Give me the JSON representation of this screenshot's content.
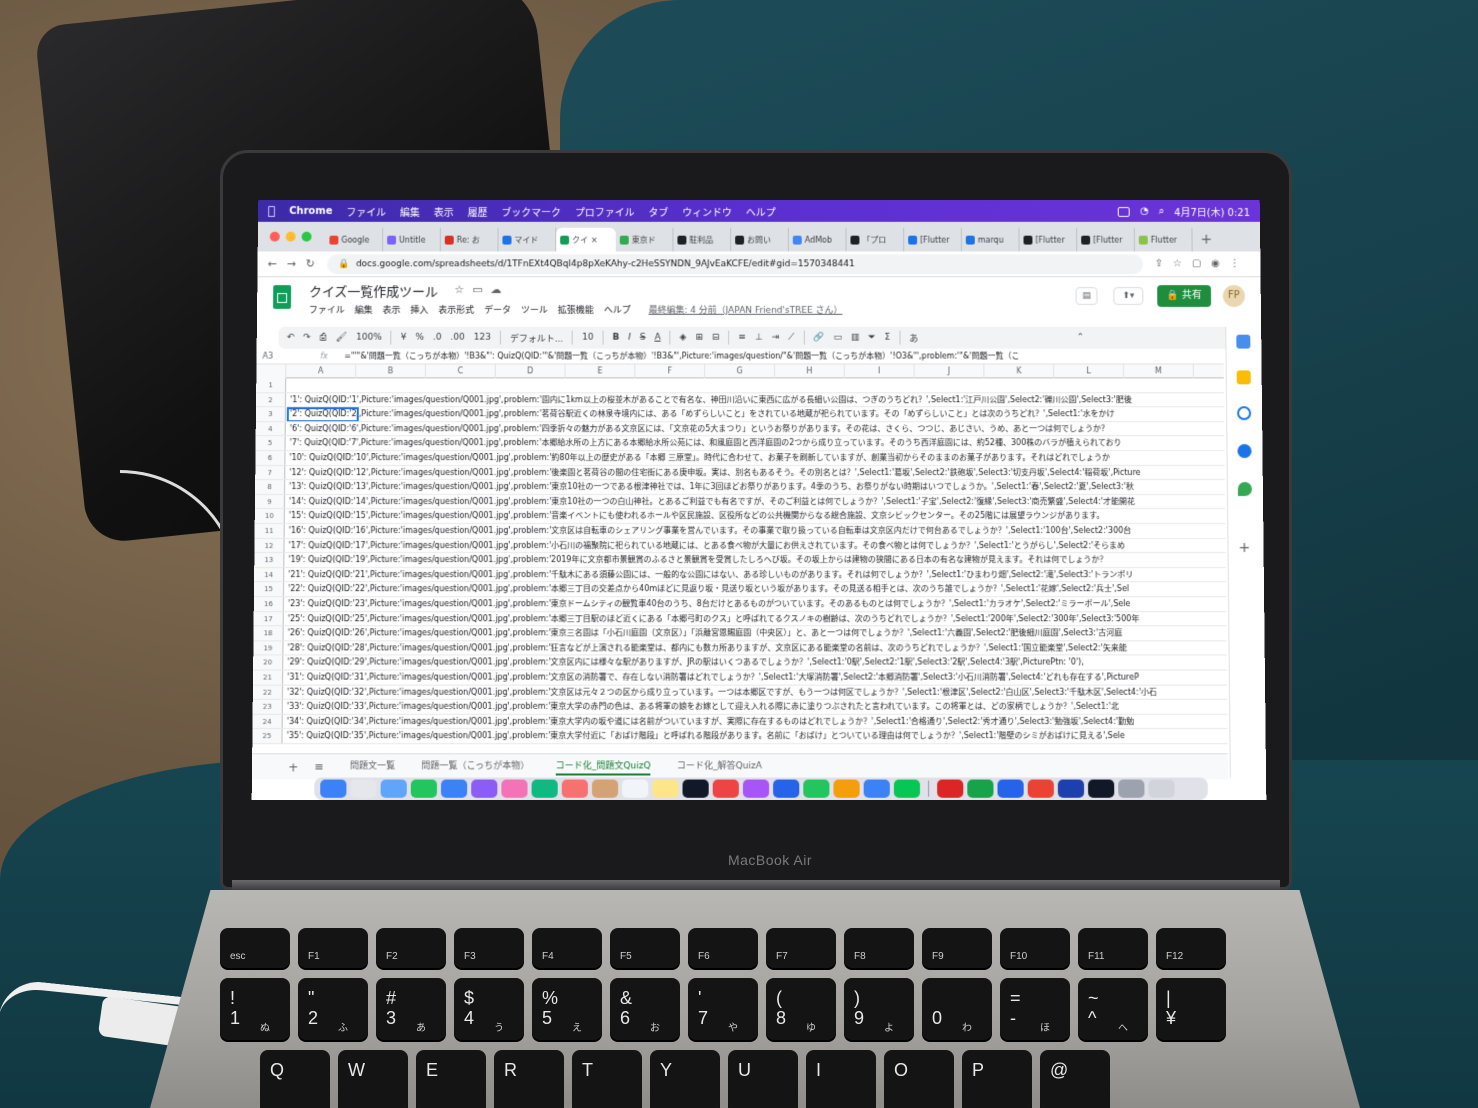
{
  "menubar": {
    "app": "Chrome",
    "items": [
      "ファイル",
      "編集",
      "表示",
      "履歴",
      "ブックマーク",
      "プロファイル",
      "タブ",
      "ウィンドウ",
      "ヘルプ"
    ],
    "clock": "4月7日(木) 0:21"
  },
  "tabs": [
    {
      "label": "Google",
      "color": "#ea4335"
    },
    {
      "label": "Untitle",
      "color": "#7b61ff"
    },
    {
      "label": "Re: お",
      "color": "#d93025"
    },
    {
      "label": "マイド",
      "color": "#1a73e8"
    },
    {
      "label": "クイ",
      "color": "#0f9d58",
      "active": true
    },
    {
      "label": "東京ド",
      "color": "#34a853"
    },
    {
      "label": "駐利品",
      "color": "#202124"
    },
    {
      "label": "お問い",
      "color": "#202124"
    },
    {
      "label": "AdMob",
      "color": "#4285f4"
    },
    {
      "label": "「プロ",
      "color": "#202124"
    },
    {
      "label": "[Flutter",
      "color": "#1a73e8"
    },
    {
      "label": "marqu",
      "color": "#1a73e8"
    },
    {
      "label": "[Flutter",
      "color": "#202124"
    },
    {
      "label": "[Flutter",
      "color": "#202124"
    },
    {
      "label": "Flutter",
      "color": "#8bc34a"
    }
  ],
  "address": {
    "url": "docs.google.com/spreadsheets/d/1TFnEXt4QBql4p8pXeKAhy-c2HeSSYNDN_9AJvEaKCFE/edit#gid=1570348441"
  },
  "sheet": {
    "title": "クイズ一覧作成ツール",
    "menus": [
      "ファイル",
      "編集",
      "表示",
      "挿入",
      "表示形式",
      "データ",
      "ツール",
      "拡張機能",
      "ヘルプ"
    ],
    "last_edit": "最終編集: 4 分前（JAPAN Friend'sTREE さん）",
    "share_label": "🔒 共有",
    "avatar": "FP"
  },
  "toolbar": {
    "zoom": "100%",
    "currency": "¥",
    "percent": "%",
    "dec1": ".0",
    "dec2": ".00",
    "format": "123",
    "font": "デフォルト...",
    "size": "10",
    "bold": "B",
    "italic": "I",
    "strike": "S",
    "color": "A",
    "input_tool": "あ"
  },
  "formula_bar": {
    "name_box": "A3",
    "fx": "fx",
    "formula": "=\"'\"&'問題一覧（こっちが本物）'!B3&\"': QuizQ(QID:'\"&'問題一覧（こっちが本物）'!B3&\"',Picture:'images/question/\"&'問題一覧（こっちが本物）'!O3&\"',problem:'\"&'問題一覧（こ"
  },
  "columns": [
    "A",
    "B",
    "C",
    "D",
    "E",
    "F",
    "G",
    "H",
    "I",
    "J",
    "K",
    "L",
    "M"
  ],
  "rows": [
    {
      "num": "1",
      "text": ""
    },
    {
      "num": "2",
      "text": "'1': QuizQ(QID:'1',Picture:'images/question/Q001.jpg',problem:'園内に1km以上の桜並木があることで有名な、神田川沿いに東西に広がる長細い公園は、つぎのうちどれ？',Select1:'江戸川公園',Select2:'礫川公園',Select3:'肥後"
    },
    {
      "num": "3",
      "text": "'2': QuizQ(QID:'2',Picture:'images/question/Q001.jpg',problem:'茗荷谷駅近くの林泉寺境内には、ある「めずらしいこと」をされている地蔵が祀られています。その「めずらしいこと」とは次のうちどれ？',Select1:'水をかけ",
      "selected": true
    },
    {
      "num": "4",
      "text": "'6': QuizQ(QID:'6',Picture:'images/question/Q001.jpg',problem:'四季折々の魅力がある文京区には、「文京花の5大まつり」というお祭りがあります。その花は、さくら、つつじ、あじさい、うめ、あと一つは何でしょうか？"
    },
    {
      "num": "5",
      "text": "'7': QuizQ(QID:'7',Picture:'images/question/Q001.jpg',problem:'本郷給水所の上方にある本郷給水所公苑には、和風庭園と西洋庭園の2つから成り立っています。そのうち西洋庭園には、約52種、300株のバラが植えられており"
    },
    {
      "num": "6",
      "text": "'10': QuizQ(QID:'10',Picture:'images/question/Q001.jpg',problem:'約80年以上の歴史がある「本郷 三原堂」。時代に合わせて、お菓子を刷新していますが、創業当初からそのままのお菓子があります。それはどれでしょうか"
    },
    {
      "num": "7",
      "text": "'12': QuizQ(QID:'12',Picture:'images/question/Q001.jpg',problem:'後楽園と茗荷谷の間の住宅街にある庚申坂。実は、別名もあるそう。その別名とは？',Select1:'葛坂',Select2:'鉄砲坂',Select3:'切支丹坂',Select4:'稲荷坂',Picture"
    },
    {
      "num": "8",
      "text": "'13': QuizQ(QID:'13',Picture:'images/question/Q001.jpg',problem:'東京10社の一つである根津神社では、1年に3回ほどお祭りがあります。4季のうち、お祭りがない時期はいつでしょうか。',Select1:'春',Select2:'夏',Select3:'秋"
    },
    {
      "num": "9",
      "text": "'14': QuizQ(QID:'14',Picture:'images/question/Q001.jpg',problem:'東京10社の一つの白山神社。とあるご利益でも有名ですが、そのご利益とは何でしょうか？',Select1:'子宝',Select2:'復縁',Select3:'商売繁盛',Select4:'才能開花"
    },
    {
      "num": "10",
      "text": "'15': QuizQ(QID:'15',Picture:'images/question/Q001.jpg',problem:'音楽イベントにも使われるホールや区民施設、区役所などの公共機関からなる総合施設、文京シビックセンター。その25階には展望ラウンジがあります。"
    },
    {
      "num": "11",
      "text": "'16': QuizQ(QID:'16',Picture:'images/question/Q001.jpg',problem:'文京区は自転車のシェアリング事業を営んでいます。その事業で取り扱っている自転車は文京区内だけで何台あるでしょうか？',Select1:'100台',Select2:'300台"
    },
    {
      "num": "12",
      "text": "'17': QuizQ(QID:'17',Picture:'images/question/Q001.jpg',problem:'小石川の福聚院に祀られている地蔵には、とある食べ物が大量にお供えされています。その食べ物とは何でしょうか？',Select1:'とうがらし',Select2:'そらまめ"
    },
    {
      "num": "13",
      "text": "'19': QuizQ(QID:'19',Picture:'images/question/Q001.jpg',problem:'2019年に文京都市景観賞のふるさと景観賞を受賞したしろへび坂。その坂上からは建物の狭間にある日本の有名な建物が見えます。それは何でしょうか？"
    },
    {
      "num": "14",
      "text": "'21': QuizQ(QID:'21',Picture:'images/question/Q001.jpg',problem:'千駄木にある須藤公園には、一般的な公園にはない、ある珍しいものがあります。それは何でしょうか？',Select1:'ひまわり畑',Select2:'滝',Select3:'トランポリ"
    },
    {
      "num": "15",
      "text": "'22': QuizQ(QID:'22',Picture:'images/question/Q001.jpg',problem:'本郷三丁目の交差点から40mほどに見返り坂・見送り坂という坂があります。その見送る相手とは、次のうち誰でしょうか？',Select1:'花嫁',Select2:'兵士',Sel"
    },
    {
      "num": "16",
      "text": "'23': QuizQ(QID:'23',Picture:'images/question/Q001.jpg',problem:'東京ドームシティの観覧車40台のうち、8台だけとあるものがついています。そのあるものとは何でしょうか？',Select1:'カラオケ',Select2:'ミラーボール',Sele"
    },
    {
      "num": "17",
      "text": "'25': QuizQ(QID:'25',Picture:'images/question/Q001.jpg',problem:'本郷三丁目駅のほど近くにある「本郷弓町のクス」と呼ばれてるクスノキの樹齢は、次のうちどれでしょうか？',Select1:'200年',Select2:'300年',Select3:'500年"
    },
    {
      "num": "18",
      "text": "'26': QuizQ(QID:'26',Picture:'images/question/Q001.jpg',problem:'東京三名園は「小石川庭園（文京区）」「浜離宮恩賜庭園（中央区）」と、あと一つは何でしょうか？',Select1:'六義園',Select2:'肥後細川庭園',Select3:'古河庭"
    },
    {
      "num": "19",
      "text": "'28': QuizQ(QID:'28',Picture:'images/question/Q001.jpg',problem:'狂言などが上演される能楽堂は、都内にも数カ所ありますが、文京区にある能楽堂の名前は、次のうちどれでしょうか？',Select1:'国立能楽堂',Select2:'矢来能"
    },
    {
      "num": "20",
      "text": "'29': QuizQ(QID:'29',Picture:'images/question/Q001.jpg',problem:'文京区内には様々な駅がありますが、JRの駅はいくつあるでしょうか？',Select1:'0駅',Select2:'1駅',Select3:'2駅',Select4:'3駅',PicturePtn: '0'),"
    },
    {
      "num": "21",
      "text": "'31': QuizQ(QID:'31',Picture:'images/question/Q001.jpg',problem:'文京区の消防署で、存在しない消防署はどれでしょうか？',Select1:'大塚消防署',Select2:'本郷消防署',Select3:'小石川消防署',Select4:'どれも存在する',PictureP"
    },
    {
      "num": "22",
      "text": "'32': QuizQ(QID:'32',Picture:'images/question/Q001.jpg',problem:'文京区は元々２つの区から成り立っています。一つは本郷区ですが、もう一つは何区でしょうか？',Select1:'根津区',Select2:'白山区',Select3:'千駄木区',Select4:'小石"
    },
    {
      "num": "23",
      "text": "'33': QuizQ(QID:'33',Picture:'images/question/Q001.jpg',problem:'東京大学の赤門の色は、ある将軍の娘をお嫁として迎え入れる際に赤に塗りつぶされたと言われています。この将軍とは、どの家柄でしょうか？',Select1:'北"
    },
    {
      "num": "24",
      "text": "'34': QuizQ(QID:'34',Picture:'images/question/Q001.jpg',problem:'東京大学内の坂や道には名前がついていますが、実際に存在するものはどれでしょうか？',Select1:'合格通り',Select2:'秀才通り',Select3:'勉強坂',Select4:'勤勉"
    },
    {
      "num": "25",
      "text": "'35': QuizQ(QID:'35',Picture:'images/question/Q001.jpg',problem:'東京大学付近に「おばけ階段」と呼ばれる階段があります。名前に「おばけ」とついている理由は何でしょうか？',Select1:'階壁のシミがおばけに見える',Sele"
    }
  ],
  "sheet_tabs": [
    "問題文一覧",
    "問題一覧（こっちが本物）",
    "コード化_問題文QuizQ",
    "コード化_解答QuizA"
  ],
  "active_sheet_tab": "コード化_問題文QuizQ",
  "laptop": {
    "label": "MacBook Air"
  },
  "keyboard": {
    "fn_row": [
      "esc",
      "F1",
      "F2",
      "F3",
      "F4",
      "F5",
      "F6",
      "F7",
      "F8",
      "F9",
      "F10",
      "F11",
      "F12"
    ],
    "num_row": [
      {
        "main": "!",
        "low": "1",
        "kana": "ぬ"
      },
      {
        "main": "\"",
        "low": "2",
        "kana": "ふ"
      },
      {
        "main": "#",
        "low": "3",
        "kana": "あ"
      },
      {
        "main": "$",
        "low": "4",
        "kana": "う"
      },
      {
        "main": "%",
        "low": "5",
        "kana": "え"
      },
      {
        "main": "&",
        "low": "6",
        "kana": "お"
      },
      {
        "main": "'",
        "low": "7",
        "kana": "や"
      },
      {
        "main": "(",
        "low": "8",
        "kana": "ゆ"
      },
      {
        "main": ")",
        "low": "9",
        "kana": "よ"
      },
      {
        "main": "",
        "low": "0",
        "kana": "わ"
      },
      {
        "main": "=",
        "low": "-",
        "kana": "ほ"
      },
      {
        "main": "~",
        "low": "^",
        "kana": "へ"
      },
      {
        "main": "|",
        "low": "¥",
        "kana": ""
      }
    ],
    "letter_row": [
      "Q",
      "W",
      "E",
      "R",
      "T",
      "Y",
      "U",
      "I",
      "O",
      "P",
      "@"
    ]
  }
}
